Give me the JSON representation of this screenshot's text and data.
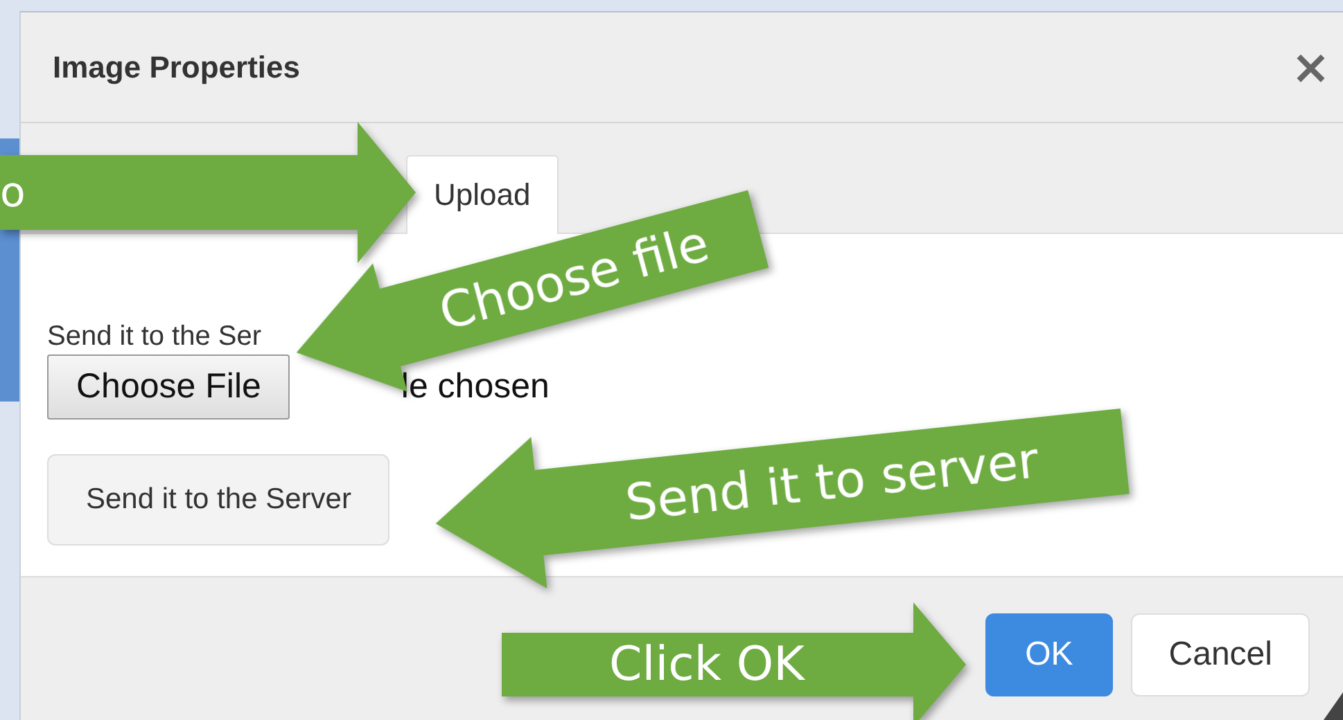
{
  "dialog": {
    "title": "Image Properties",
    "close": "×",
    "tabs": [
      {
        "label": "Upload",
        "selected": true
      }
    ],
    "upload": {
      "label": "Send it to the Ser",
      "file_button": "Choose File",
      "file_status": "le chosen",
      "send_button": "Send it to the Server"
    },
    "buttons": [
      {
        "label": "OK",
        "kind": "primary"
      },
      {
        "label": "Cancel",
        "kind": "default"
      }
    ]
  },
  "annotations": [
    {
      "text": "o",
      "kind": "right"
    },
    {
      "text": "Choose file",
      "kind": "left"
    },
    {
      "text": "Send it to server",
      "kind": "left"
    },
    {
      "text": "Click OK",
      "kind": "right"
    }
  ]
}
